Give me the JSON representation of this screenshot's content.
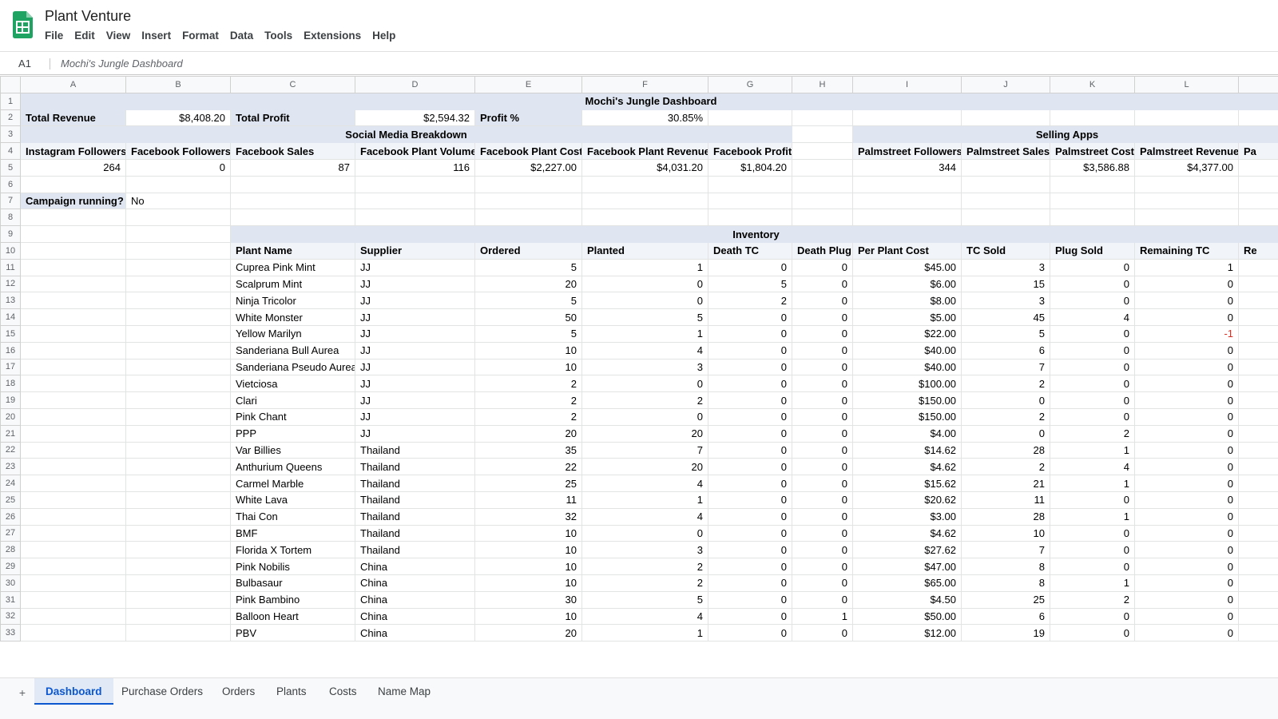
{
  "app": {
    "title": "Plant Venture",
    "logo_icon": "google-sheets-icon",
    "accent_color": "#0b57d0",
    "menu": [
      "File",
      "Edit",
      "View",
      "Insert",
      "Format",
      "Data",
      "Tools",
      "Extensions",
      "Help"
    ]
  },
  "formula_bar": {
    "cell_ref": "A1",
    "content": "Mochi's Jungle Dashboard"
  },
  "grid": {
    "columns": [
      "A",
      "B",
      "C",
      "D",
      "E",
      "F",
      "G",
      "H",
      "I",
      "J",
      "K",
      "L",
      ""
    ],
    "dashboard_title": "Mochi's Jungle Dashboard",
    "summary": {
      "total_revenue_label": "Total Revenue",
      "total_revenue": "$8,408.20",
      "total_profit_label": "Total Profit",
      "total_profit": "$2,594.32",
      "profit_pct_label": "Profit %",
      "profit_pct": "30.85%"
    },
    "social_media_title": "Social Media Breakdown",
    "selling_apps_title": "Selling Apps",
    "social_headers": [
      "Instagram Followers",
      "Facebook Followers",
      "Facebook Sales",
      "Facebook Plant Volume",
      "Facebook Plant Cost",
      "Facebook Plant Revenue",
      "Facebook Profit"
    ],
    "social_values": [
      "264",
      "0",
      "87",
      "116",
      "$2,227.00",
      "$4,031.20",
      "$1,804.20"
    ],
    "apps_headers": [
      "Palmstreet Followers",
      "Palmstreet Sales",
      "Palmstreet Cost",
      "Palmstreet Revenue",
      "Pa"
    ],
    "apps_values": [
      "344",
      "",
      "$3,586.88",
      "$4,377.00",
      ""
    ],
    "campaign_label": "Campaign running?",
    "campaign_value": "No",
    "inventory_title": "Inventory",
    "inventory_headers": [
      "Plant Name",
      "Supplier",
      "Ordered",
      "Planted",
      "Death TC",
      "Death Plug",
      "Per Plant Cost",
      "TC Sold",
      "Plug Sold",
      "Remaining TC",
      "Re"
    ],
    "inventory_rows": [
      [
        "Cuprea Pink Mint",
        "JJ",
        "5",
        "1",
        "0",
        "0",
        "$45.00",
        "3",
        "0",
        "1"
      ],
      [
        "Scalprum Mint",
        "JJ",
        "20",
        "0",
        "5",
        "0",
        "$6.00",
        "15",
        "0",
        "0"
      ],
      [
        "Ninja Tricolor",
        "JJ",
        "5",
        "0",
        "2",
        "0",
        "$8.00",
        "3",
        "0",
        "0"
      ],
      [
        "White Monster",
        "JJ",
        "50",
        "5",
        "0",
        "0",
        "$5.00",
        "45",
        "4",
        "0"
      ],
      [
        "Yellow Marilyn",
        "JJ",
        "5",
        "1",
        "0",
        "0",
        "$22.00",
        "5",
        "0",
        "-1"
      ],
      [
        "Sanderiana Bull Aurea",
        "JJ",
        "10",
        "4",
        "0",
        "0",
        "$40.00",
        "6",
        "0",
        "0"
      ],
      [
        "Sanderiana Pseudo Aurea",
        "JJ",
        "10",
        "3",
        "0",
        "0",
        "$40.00",
        "7",
        "0",
        "0"
      ],
      [
        "Vietciosa",
        "JJ",
        "2",
        "0",
        "0",
        "0",
        "$100.00",
        "2",
        "0",
        "0"
      ],
      [
        "Clari",
        "JJ",
        "2",
        "2",
        "0",
        "0",
        "$150.00",
        "0",
        "0",
        "0"
      ],
      [
        "Pink Chant",
        "JJ",
        "2",
        "0",
        "0",
        "0",
        "$150.00",
        "2",
        "0",
        "0"
      ],
      [
        "PPP",
        "JJ",
        "20",
        "20",
        "0",
        "0",
        "$4.00",
        "0",
        "2",
        "0"
      ],
      [
        "Var Billies",
        "Thailand",
        "35",
        "7",
        "0",
        "0",
        "$14.62",
        "28",
        "1",
        "0"
      ],
      [
        "Anthurium Queens",
        "Thailand",
        "22",
        "20",
        "0",
        "0",
        "$4.62",
        "2",
        "4",
        "0"
      ],
      [
        "Carmel Marble",
        "Thailand",
        "25",
        "4",
        "0",
        "0",
        "$15.62",
        "21",
        "1",
        "0"
      ],
      [
        "White Lava",
        "Thailand",
        "11",
        "1",
        "0",
        "0",
        "$20.62",
        "11",
        "0",
        "0"
      ],
      [
        "Thai Con",
        "Thailand",
        "32",
        "4",
        "0",
        "0",
        "$3.00",
        "28",
        "1",
        "0"
      ],
      [
        "BMF",
        "Thailand",
        "10",
        "0",
        "0",
        "0",
        "$4.62",
        "10",
        "0",
        "0"
      ],
      [
        "Florida X Tortem",
        "Thailand",
        "10",
        "3",
        "0",
        "0",
        "$27.62",
        "7",
        "0",
        "0"
      ],
      [
        "Pink Nobilis",
        "China",
        "10",
        "2",
        "0",
        "0",
        "$47.00",
        "8",
        "0",
        "0"
      ],
      [
        "Bulbasaur",
        "China",
        "10",
        "2",
        "0",
        "0",
        "$65.00",
        "8",
        "1",
        "0"
      ],
      [
        "Pink Bambino",
        "China",
        "30",
        "5",
        "0",
        "0",
        "$4.50",
        "25",
        "2",
        "0"
      ],
      [
        "Balloon Heart",
        "China",
        "10",
        "4",
        "0",
        "1",
        "$50.00",
        "6",
        "0",
        "0"
      ],
      [
        "PBV",
        "China",
        "20",
        "1",
        "0",
        "0",
        "$12.00",
        "19",
        "0",
        "0"
      ]
    ]
  },
  "sheet_tabs": {
    "add_label": "+",
    "active_index": 0,
    "tabs": [
      "Dashboard",
      "Purchase Orders",
      "Orders",
      "Plants",
      "Costs",
      "Name Map"
    ]
  }
}
